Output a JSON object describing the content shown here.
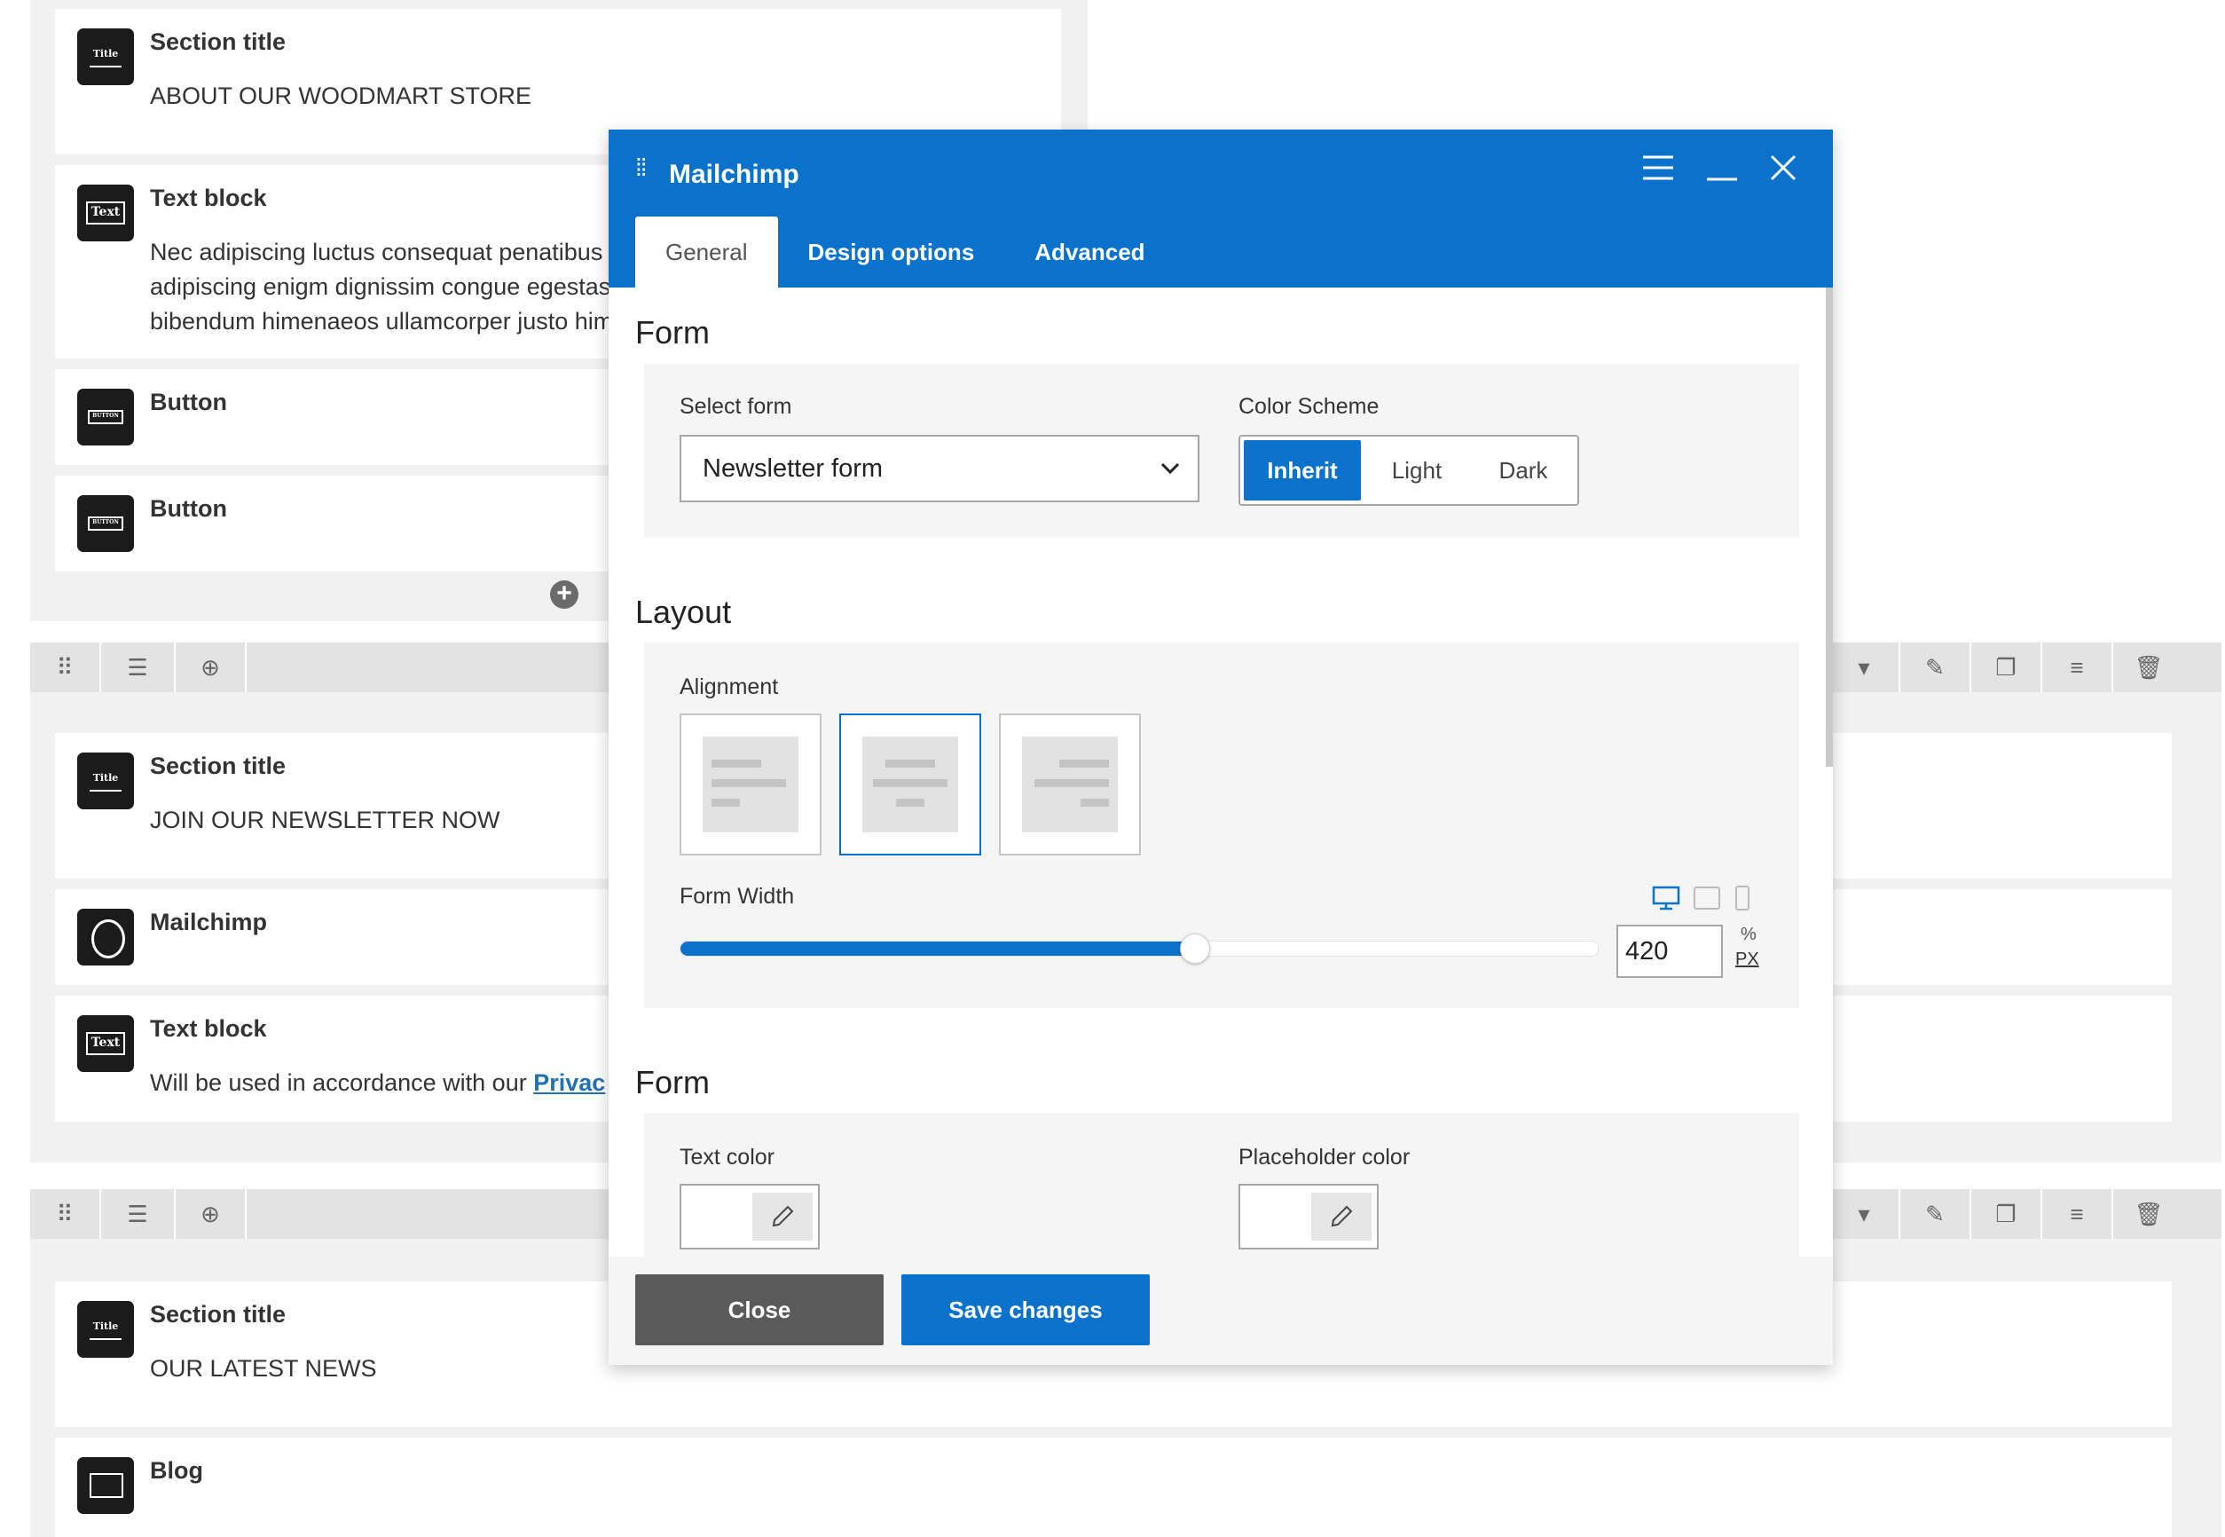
{
  "builder": {
    "group1": {
      "section_title": {
        "title": "Section title",
        "text": "ABOUT OUR WOODMART STORE",
        "icon": "title-icon"
      },
      "text_block": {
        "title": "Text block",
        "lines": [
          "Nec  adipiscing luctus consequat penatibus",
          "adipiscing enigm dignissim congue egestas",
          "bibendum himenaeos ullamcorper justo him"
        ],
        "icon": "text-icon"
      },
      "button1": {
        "title": "Button",
        "icon": "button-icon"
      },
      "button2": {
        "title": "Button",
        "icon": "button-icon"
      }
    },
    "group2": {
      "section_title": {
        "title": "Section title",
        "text": "JOIN OUR NEWSLETTER NOW"
      },
      "mailchimp": {
        "title": "Mailchimp",
        "icon": "mailchimp-icon"
      },
      "text_block": {
        "title": "Text block",
        "text": "Will be used in accordance with our ",
        "link": "Privac"
      }
    },
    "group3": {
      "section_title": {
        "title": "Section title",
        "text": "OUR LATEST NEWS"
      },
      "blog": {
        "title": "Blog",
        "icon": "blog-icon"
      }
    },
    "icon_labels": {
      "title": "Title",
      "text": "Text",
      "button": "BUTTON"
    }
  },
  "modal": {
    "title": "Mailchimp",
    "tabs": [
      "General",
      "Design options",
      "Advanced"
    ],
    "active_tab": "General",
    "sections": {
      "form": {
        "heading": "Form",
        "select_label": "Select form",
        "select_value": "Newsletter form",
        "scheme_label": "Color Scheme",
        "scheme_options": [
          "Inherit",
          "Light",
          "Dark"
        ],
        "scheme_selected": "Inherit"
      },
      "layout": {
        "heading": "Layout",
        "alignment_label": "Alignment",
        "alignment_options": [
          "left",
          "center",
          "right"
        ],
        "alignment_selected": "center",
        "width_label": "Form Width",
        "width_value": "420",
        "width_fraction": 0.56,
        "units": [
          "%",
          "PX"
        ],
        "unit_selected": "PX",
        "devices": [
          "desktop-icon",
          "tablet-icon",
          "mobile-icon"
        ]
      },
      "form_colors": {
        "heading": "Form",
        "text_color_label": "Text color",
        "placeholder_color_label": "Placeholder color"
      }
    },
    "buttons": {
      "close": "Close",
      "save": "Save changes"
    }
  },
  "colors": {
    "accent": "#0a72cb",
    "close_btn": "#5a5a5a"
  }
}
